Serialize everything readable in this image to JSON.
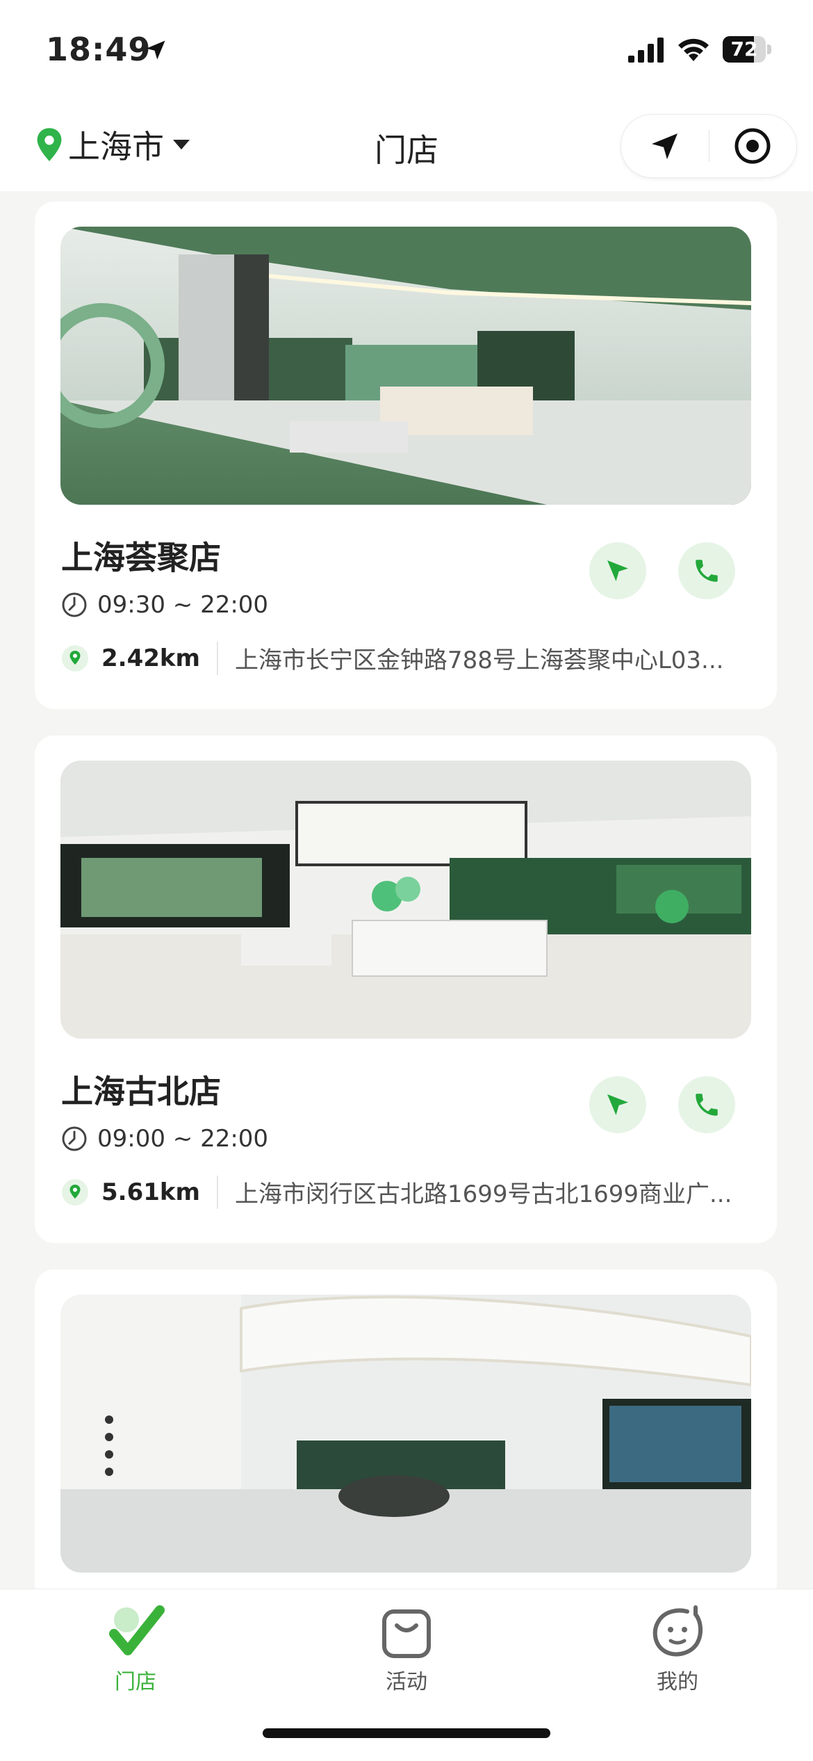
{
  "status_bar": {
    "time": "18:49",
    "battery": "72",
    "battery_level": 0.72
  },
  "nav": {
    "city": "上海市",
    "title": "门店"
  },
  "stores": [
    {
      "name": "上海荟聚店",
      "hours": "09:30 ~ 22:00",
      "distance": "2.42km",
      "address": "上海市长宁区金钟路788号上海荟聚中心L03..."
    },
    {
      "name": "上海古北店",
      "hours": "09:00 ~ 22:00",
      "distance": "5.61km",
      "address": "上海市闵行区古北路1699号古北1699商业广..."
    }
  ],
  "tabs": [
    {
      "label": "门店",
      "icon": "golf-check-icon",
      "active": true
    },
    {
      "label": "活动",
      "icon": "shopping-bag-icon",
      "active": false
    },
    {
      "label": "我的",
      "icon": "smiley-face-icon",
      "active": false
    }
  ],
  "colors": {
    "accent": "#3ab23a",
    "icon_bg": "#e6f4e6",
    "background": "#f5f5f3"
  }
}
